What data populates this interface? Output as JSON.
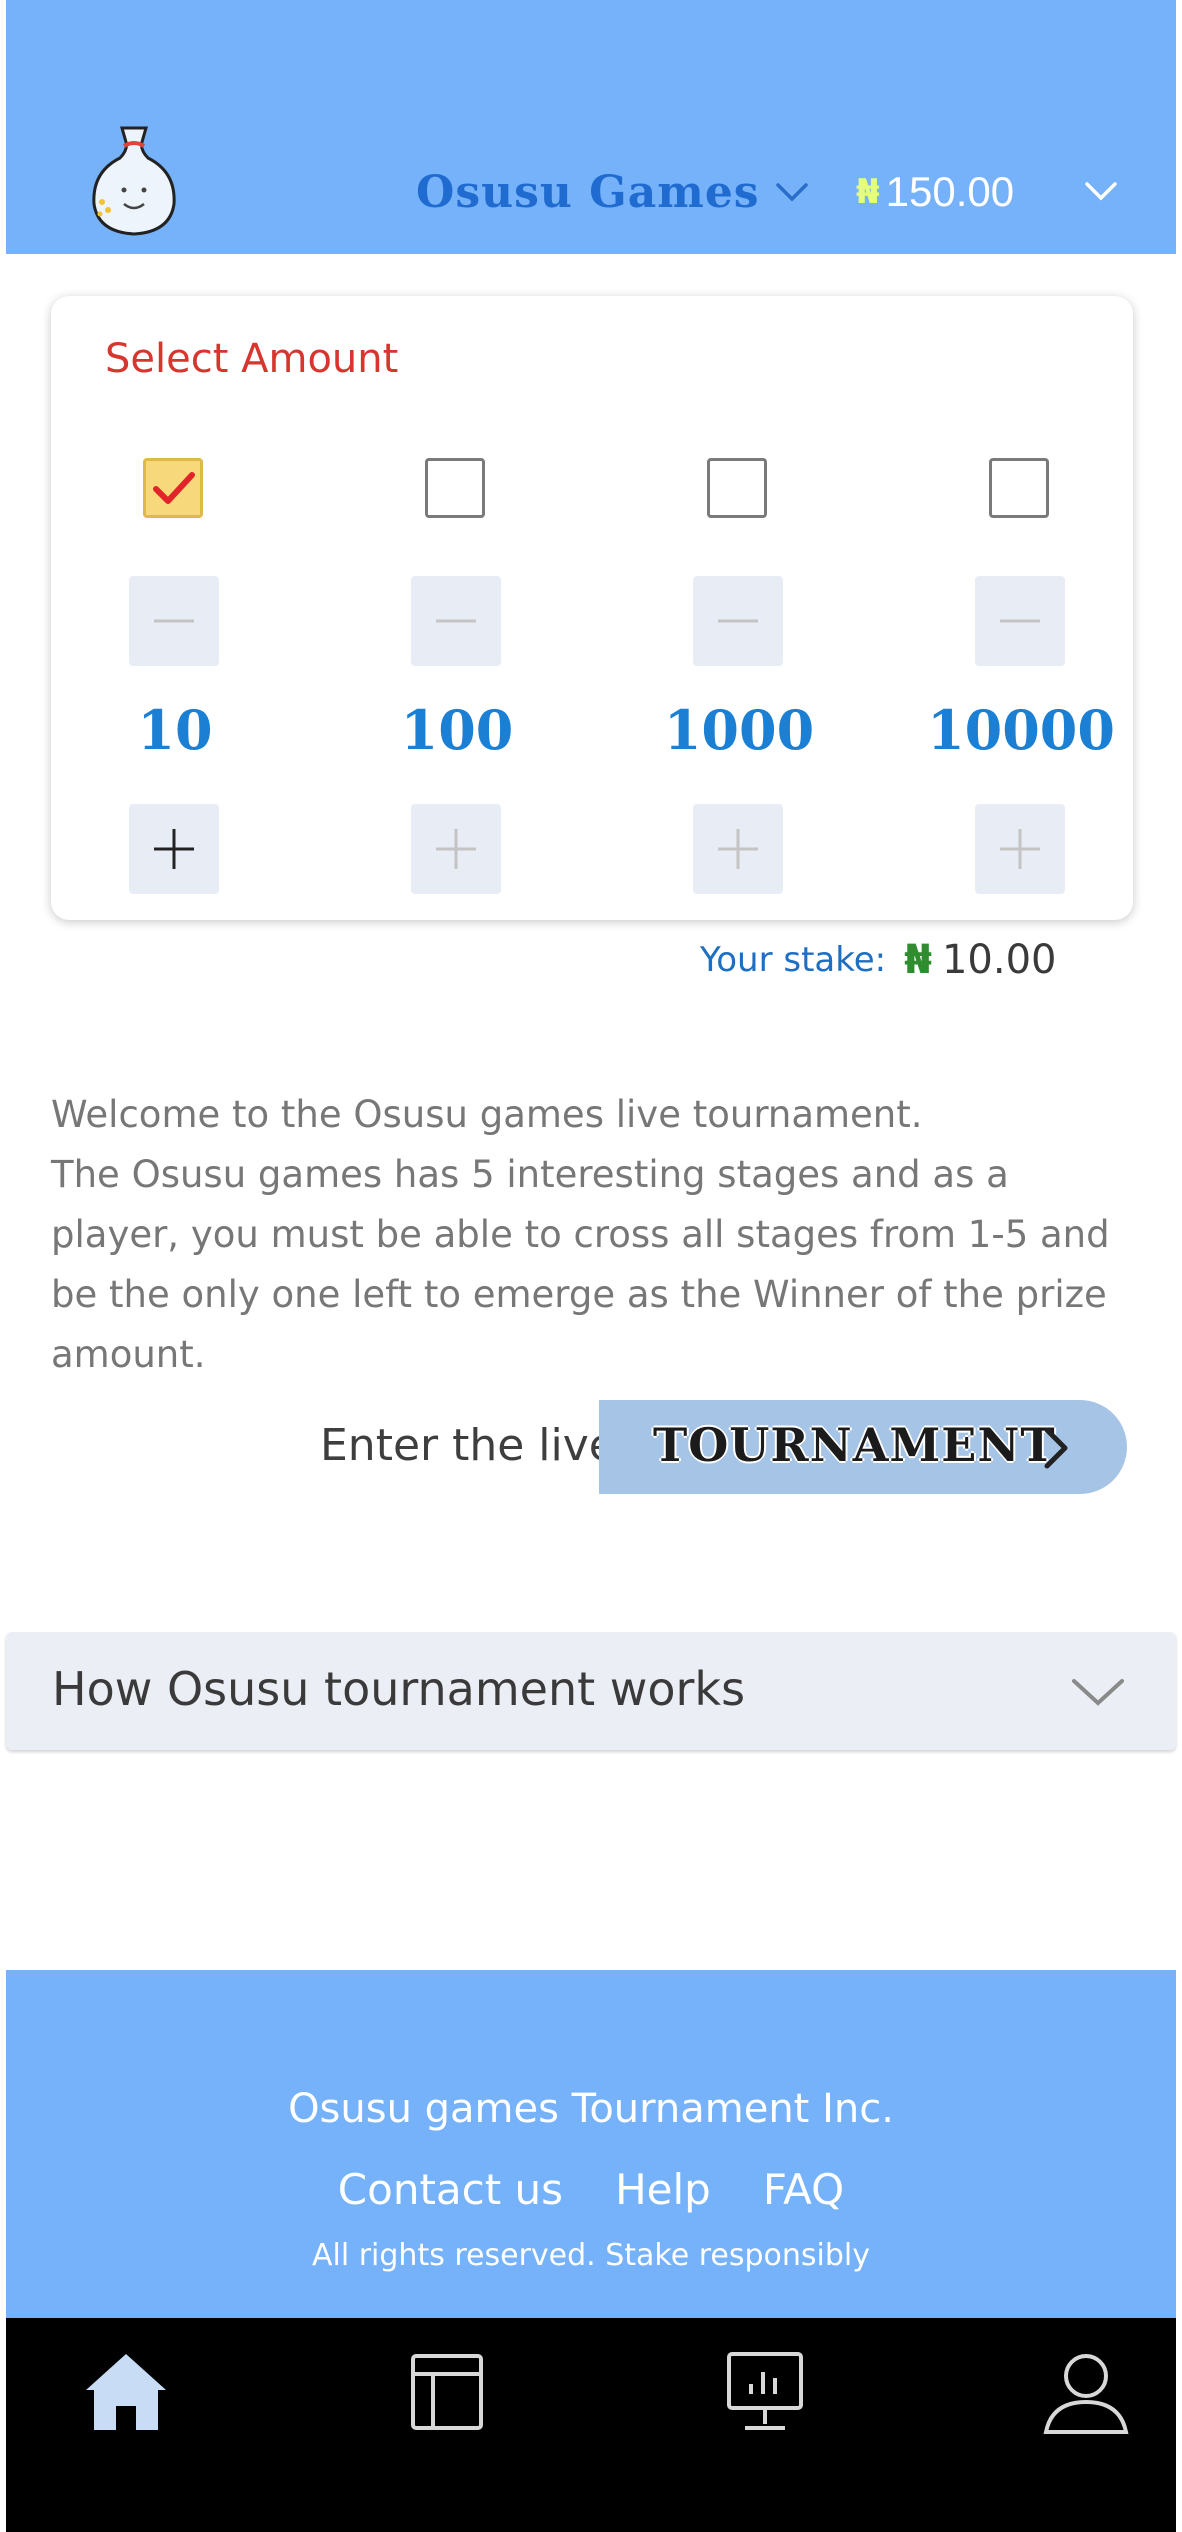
{
  "header": {
    "brand": "Osusu Games",
    "balance_currency": "₦",
    "balance": "150.00",
    "icons": [
      "logo-pot-icon",
      "chevron-down-icon",
      "chevron-down-icon"
    ]
  },
  "amount_card": {
    "title": "Select Amount",
    "options": [
      {
        "amount": "10",
        "checked": true
      },
      {
        "amount": "100",
        "checked": false
      },
      {
        "amount": "1000",
        "checked": false
      },
      {
        "amount": "10000",
        "checked": false
      }
    ]
  },
  "stake": {
    "label": "Your stake:",
    "currency": "₦",
    "value": "10.00"
  },
  "description": {
    "line1": "Welcome to the Osusu games live tournament.",
    "line2": "The Osusu games has 5 interesting stages and as a player, you must be able to cross all stages from 1-5 and be the only one left to emerge as the Winner of the prize amount."
  },
  "tournament": {
    "label": "Enter the live",
    "button": "TOURNAMENT"
  },
  "accordion": {
    "title": "How Osusu tournament works"
  },
  "footer": {
    "company": "Osusu games Tournament Inc.",
    "links": [
      "Contact us",
      "Help",
      "FAQ"
    ],
    "rights": "All rights reserved.  Stake responsibly"
  },
  "bottom_nav": {
    "items": [
      "home-icon",
      "layout-icon",
      "monitor-chart-icon",
      "profile-icon"
    ]
  },
  "colors": {
    "header_bg": "#75b2fa",
    "brand": "#1f6bd0",
    "title_red": "#d7362f",
    "amount_blue": "#1b7fd4",
    "checked_bg": "#f7d97c"
  }
}
